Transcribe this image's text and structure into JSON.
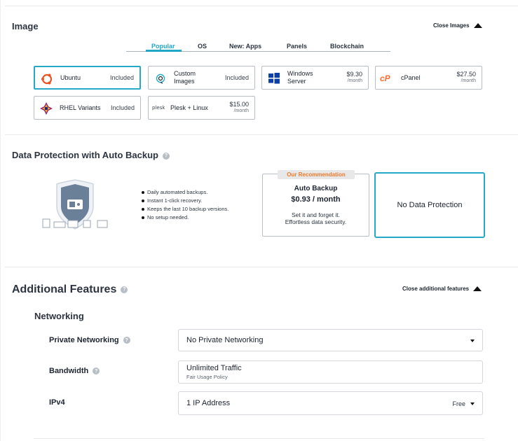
{
  "image": {
    "title": "Image",
    "close_label": "Close Images",
    "tabs": [
      "Popular",
      "OS",
      "New: Apps",
      "Panels",
      "Blockchain"
    ],
    "active_tab": "Popular",
    "cards": [
      {
        "name": "Ubuntu",
        "note": "Included",
        "selected": true,
        "icon": "ubuntu-icon"
      },
      {
        "name": "Custom Images",
        "note": "Included",
        "icon": "custom-image-icon"
      },
      {
        "name": "Windows Server",
        "price": "$9.30",
        "period": "/month",
        "icon": "windows-icon"
      },
      {
        "name": "cPanel",
        "price": "$27.50",
        "period": "/month",
        "icon": "cpanel-icon"
      },
      {
        "name": "RHEL Variants",
        "note": "Included",
        "icon": "rhel-icon"
      },
      {
        "name": "Plesk + Linux",
        "price": "$15.00",
        "period": "/month",
        "icon": "plesk-icon",
        "logo_text": "plesk"
      }
    ]
  },
  "data_protection": {
    "title": "Data Protection with Auto Backup",
    "bullets": [
      "Daily automated backups.",
      "Instant 1-click recovery.",
      "Keeps the last 10 backup versions.",
      "No setup needed."
    ],
    "recommendation": {
      "badge": "Our Recommendation",
      "title": "Auto Backup",
      "price": "$0.93 / month",
      "desc_line1": "Set it and forget it.",
      "desc_line2": "Effortless data security."
    },
    "no_protection_label": "No Data Protection"
  },
  "additional": {
    "title": "Additional Features",
    "close_label": "Close additional features",
    "networking_title": "Networking",
    "private_networking": {
      "label": "Private Networking",
      "value": "No Private Networking"
    },
    "bandwidth": {
      "label": "Bandwidth",
      "value": "Unlimited Traffic",
      "sub": "Fair Usage Policy"
    },
    "ipv4": {
      "label": "IPv4",
      "value": "1 IP Address",
      "price": "Free"
    }
  },
  "colors": {
    "accent": "#26a9c7",
    "recommend": "#ef7a2b",
    "ubuntu": "#e95420",
    "cpanel": "#ff6c2c",
    "windows": "#0a3ea8"
  }
}
